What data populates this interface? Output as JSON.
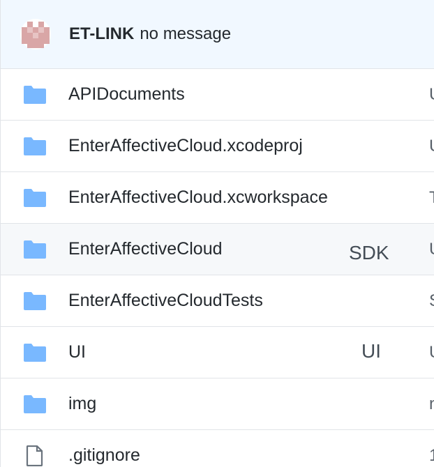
{
  "commit": {
    "author": "ET-LINK",
    "message": "no message"
  },
  "colors": {
    "folder": "#79b8ff",
    "file": "#6a737d",
    "header_bg": "#f1f8ff",
    "highlight_bg": "#f6f8fa",
    "border": "#e1e4e8"
  },
  "files": [
    {
      "type": "folder",
      "icon": "folder-icon",
      "name": "APIDocuments",
      "description": "",
      "edge": "U"
    },
    {
      "type": "folder",
      "icon": "folder-icon",
      "name": "EnterAffectiveCloud.xcodeproj",
      "description": "",
      "edge": "U"
    },
    {
      "type": "folder",
      "icon": "folder-icon",
      "name": "EnterAffectiveCloud.xcworkspace",
      "description": "",
      "edge": "T"
    },
    {
      "type": "folder",
      "icon": "folder-icon",
      "name": "EnterAffectiveCloud",
      "description": "SDK",
      "edge": "U"
    },
    {
      "type": "folder",
      "icon": "folder-icon",
      "name": "EnterAffectiveCloudTests",
      "description": "",
      "edge": "S"
    },
    {
      "type": "folder",
      "icon": "folder-icon",
      "name": "UI",
      "description": "UI",
      "edge": "U"
    },
    {
      "type": "folder",
      "icon": "folder-icon",
      "name": "img",
      "description": "",
      "edge": "n"
    },
    {
      "type": "file",
      "icon": "file-icon",
      "name": ".gitignore",
      "description": "",
      "edge": "1"
    }
  ]
}
